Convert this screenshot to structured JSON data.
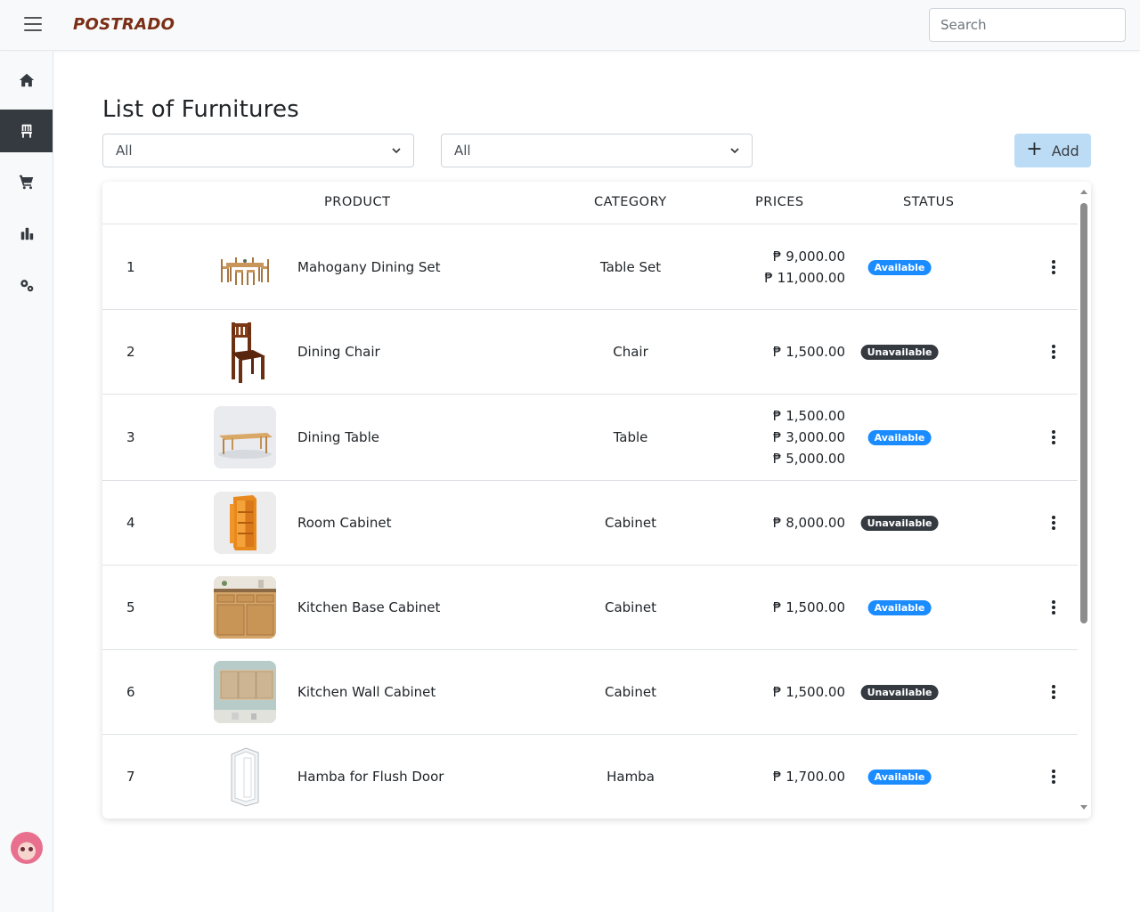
{
  "app": {
    "brand": "POSTRADO"
  },
  "search": {
    "placeholder": "Search"
  },
  "sidebar": {
    "items": [
      {
        "icon": "home-icon",
        "active": false
      },
      {
        "icon": "chair-icon",
        "active": true
      },
      {
        "icon": "cart-icon",
        "active": false
      },
      {
        "icon": "bar-chart-icon",
        "active": false
      },
      {
        "icon": "gears-icon",
        "active": false
      }
    ]
  },
  "page": {
    "title": "List of Furnitures"
  },
  "filters": {
    "filter1_value": "All",
    "filter2_value": "All"
  },
  "toolbar": {
    "add_label": "Add"
  },
  "table": {
    "headers": {
      "product": "PRODUCT",
      "category": "CATEGORY",
      "prices": "PRICES",
      "status": "STATUS"
    },
    "rows": [
      {
        "no": "1",
        "name": "Mahogany Dining Set",
        "category": "Table Set",
        "prices": [
          "₱ 9,000.00",
          "₱ 11,000.00"
        ],
        "status": "Available",
        "image": "dining-set-image"
      },
      {
        "no": "2",
        "name": "Dining Chair",
        "category": "Chair",
        "prices": [
          "₱ 1,500.00"
        ],
        "status": "Unavailable",
        "image": "chair-image"
      },
      {
        "no": "3",
        "name": "Dining Table",
        "category": "Table",
        "prices": [
          "₱ 1,500.00",
          "₱ 3,000.00",
          "₱ 5,000.00"
        ],
        "status": "Available",
        "image": "table-image"
      },
      {
        "no": "4",
        "name": "Room Cabinet",
        "category": "Cabinet",
        "prices": [
          "₱ 8,000.00"
        ],
        "status": "Unavailable",
        "image": "cabinet-image"
      },
      {
        "no": "5",
        "name": "Kitchen Base Cabinet",
        "category": "Cabinet",
        "prices": [
          "₱ 1,500.00"
        ],
        "status": "Available",
        "image": "base-cabinet-image"
      },
      {
        "no": "6",
        "name": "Kitchen Wall Cabinet",
        "category": "Cabinet",
        "prices": [
          "₱ 1,500.00"
        ],
        "status": "Unavailable",
        "image": "wall-cabinet-image"
      },
      {
        "no": "7",
        "name": "Hamba for Flush Door",
        "category": "Hamba",
        "prices": [
          "₱ 1,700.00"
        ],
        "status": "Available",
        "image": "door-frame-image"
      }
    ]
  },
  "colors": {
    "brand": "#7a2e15",
    "available": "#1a8cff",
    "unavailable": "#343a40",
    "add_button": "#bcdcf5",
    "sidebar_active": "#343a40"
  }
}
